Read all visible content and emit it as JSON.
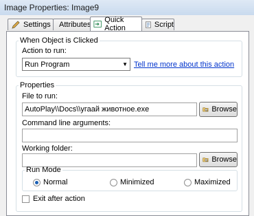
{
  "window": {
    "title": "Image Properties: Image9"
  },
  "tabs": [
    {
      "label": "Settings"
    },
    {
      "label": "Attributes"
    },
    {
      "label": "Quick Action"
    },
    {
      "label": "Script"
    }
  ],
  "when_clicked": {
    "legend": "When Object is Clicked",
    "action_label": "Action to run:",
    "action_value": "Run Program",
    "help_link": "Tell me more about this action"
  },
  "properties": {
    "legend": "Properties",
    "file_label": "File to run:",
    "file_value": "AutoPlay\\\\Docs\\\\угаай животное.exe",
    "browse_label": "Browse",
    "args_label": "Command line arguments:",
    "args_value": "",
    "working_label": "Working folder:",
    "working_value": "",
    "run_mode": {
      "legend": "Run Mode",
      "options": [
        "Normal",
        "Minimized",
        "Maximized"
      ],
      "selected": "Normal"
    },
    "exit_after_label": "Exit after action"
  }
}
